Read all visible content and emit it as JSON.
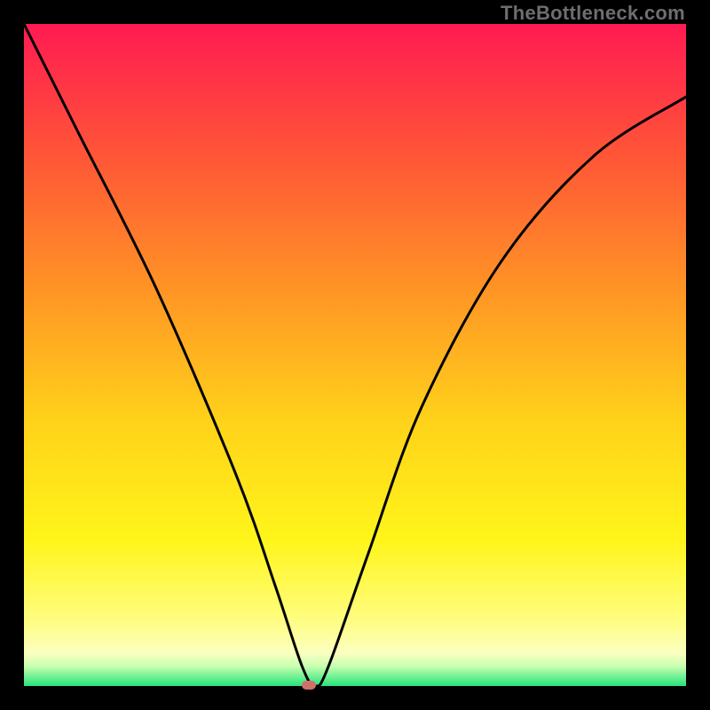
{
  "watermark": "TheBottleneck.com",
  "colors": {
    "frame_border": "#000000",
    "gradient_top": "#ff1a52",
    "gradient_bottom": "#25e47a",
    "curve": "#000000",
    "marker": "#cf7169"
  },
  "chart_data": {
    "type": "line",
    "title": "",
    "xlabel": "",
    "ylabel": "",
    "xlim": [
      0,
      100
    ],
    "ylim": [
      0,
      100
    ],
    "grid": false,
    "legend": false,
    "note": "V-shaped bottleneck curve. No axis ticks or numeric labels visible; percentages estimated from pixel position within plot area.",
    "series": [
      {
        "name": "bottleneck-curve",
        "x": [
          0,
          8,
          20,
          32,
          38,
          42,
          44,
          46,
          52,
          60,
          72,
          86,
          100
        ],
        "y": [
          100,
          84,
          60,
          32,
          15,
          3,
          0,
          3,
          20,
          42,
          64,
          80,
          89
        ]
      }
    ],
    "marker": {
      "x": 43,
      "y": 0
    }
  }
}
